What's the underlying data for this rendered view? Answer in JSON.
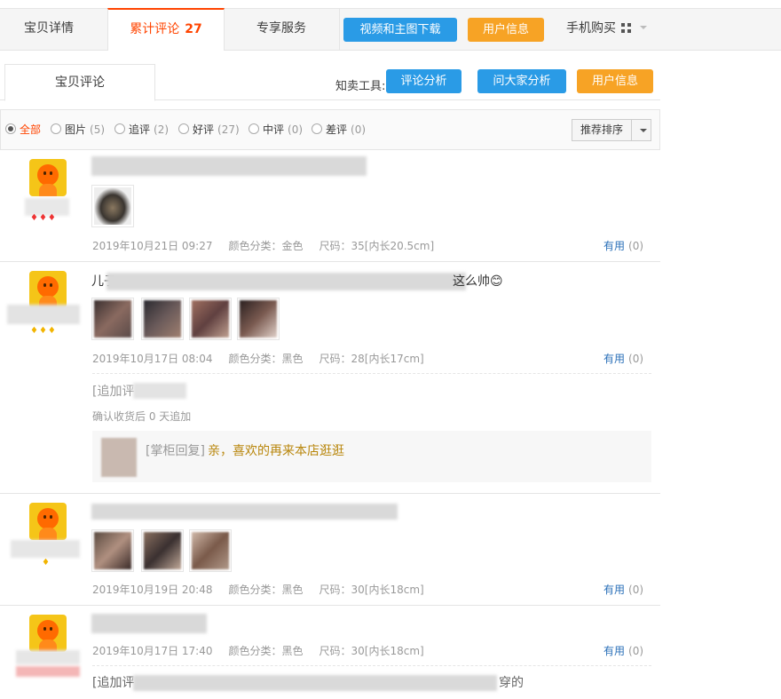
{
  "top_tabs": {
    "details": "宝贝详情",
    "reviews_label": "累计评论",
    "reviews_count": "27",
    "service": "专享服务",
    "video_download": "视频和主图下载",
    "user_info": "用户信息",
    "mobile_buy": "手机购买"
  },
  "sub_tabs": {
    "reviews": "宝贝评论",
    "tools_label": "知卖工具:",
    "review_analysis": "评论分析",
    "qa_analysis": "问大家分析",
    "user_info": "用户信息"
  },
  "filters": [
    {
      "label": "全部",
      "count": "",
      "selected": true
    },
    {
      "label": "图片",
      "count": "(5)",
      "selected": false
    },
    {
      "label": "追评",
      "count": "(2)",
      "selected": false
    },
    {
      "label": "好评",
      "count": "(27)",
      "selected": false
    },
    {
      "label": "中评",
      "count": "(0)",
      "selected": false
    },
    {
      "label": "差评",
      "count": "(0)",
      "selected": false
    }
  ],
  "sort": {
    "label": "推荐排序"
  },
  "reviews": [
    {
      "text": "",
      "date": "2019年10月21日 09:27",
      "color": "颜色分类：金色",
      "size": "尺码：35[内长20.5cm]",
      "useful": "有用",
      "useful_count": "(0)"
    },
    {
      "text_start": "儿子",
      "text_end": "这么帅😊",
      "date": "2019年10月17日 08:04",
      "color": "颜色分类：黑色",
      "size": "尺码：28[内长17cm]",
      "useful": "有用",
      "useful_count": "(0)",
      "append_label": "[追加评",
      "delivered": "确认收货后 0 天追加",
      "reply_tag": "[掌柜回复]",
      "reply_msg": "亲，喜欢的再来本店逛逛"
    },
    {
      "text": "",
      "date": "2019年10月19日 20:48",
      "color": "颜色分类：黑色",
      "size": "尺码：30[内长18cm]",
      "useful": "有用",
      "useful_count": "(0)"
    },
    {
      "text": "",
      "date": "2019年10月17日 17:40",
      "color": "颜色分类：黑色",
      "size": "尺码：30[内长18cm]",
      "useful": "有用",
      "useful_count": "(0)",
      "append_label": "[追加评",
      "append_end": "穿的"
    }
  ],
  "colors": {
    "accent": "#ff4400",
    "blue_button": "#2a9be6",
    "orange_button": "#f7a325",
    "useful_link": "#2a6fb8",
    "reply_text": "#b8860b"
  },
  "icons": [
    "qr-code-icon",
    "chevron-down-icon",
    "radio-icon",
    "avatar-icon",
    "rank-gem-icon"
  ]
}
